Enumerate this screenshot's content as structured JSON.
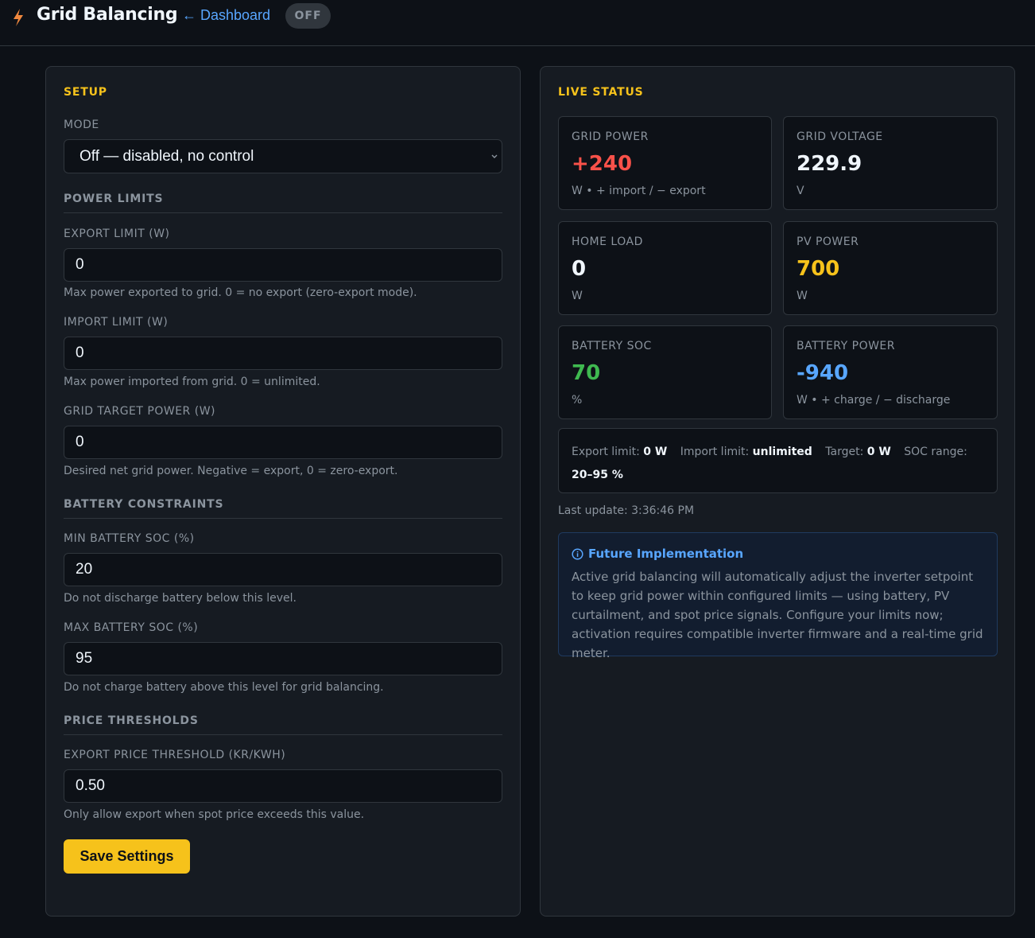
{
  "header": {
    "title": "Grid Balancing",
    "back_link": "← Dashboard",
    "status": "OFF",
    "icon": "lightning-bolt-icon"
  },
  "setup": {
    "title": "SETUP",
    "mode": {
      "label": "MODE",
      "selected": "Off — disabled, no control"
    },
    "power_limits": {
      "title": "POWER LIMITS",
      "export_limit": {
        "label": "EXPORT LIMIT (W)",
        "value": "0",
        "hint": "Max power exported to grid. 0 = no export (zero-export mode)."
      },
      "import_limit": {
        "label": "IMPORT LIMIT (W)",
        "value": "0",
        "hint": "Max power imported from grid. 0 = unlimited."
      },
      "grid_target": {
        "label": "GRID TARGET POWER (W)",
        "value": "0",
        "hint": "Desired net grid power. Negative = export, 0 = zero-export."
      }
    },
    "battery_constraints": {
      "title": "BATTERY CONSTRAINTS",
      "min_soc": {
        "label": "MIN BATTERY SOC (%)",
        "value": "20",
        "hint": "Do not discharge battery below this level."
      },
      "max_soc": {
        "label": "MAX BATTERY SOC (%)",
        "value": "95",
        "hint": "Do not charge battery above this level for grid balancing."
      }
    },
    "price_thresholds": {
      "title": "PRICE THRESHOLDS",
      "export_price": {
        "label": "EXPORT PRICE THRESHOLD (KR/KWH)",
        "value": "0.50",
        "hint": "Only allow export when spot price exceeds this value."
      }
    },
    "save_label": "Save Settings"
  },
  "live": {
    "title": "LIVE STATUS",
    "cards": {
      "grid_power": {
        "label": "GRID POWER",
        "value": "+240",
        "unit": "W  •  + import / − export",
        "color": "#f85149"
      },
      "grid_voltage": {
        "label": "GRID VOLTAGE",
        "value": "229.9",
        "unit": "V",
        "color": "#f0f6fc"
      },
      "home_load": {
        "label": "HOME LOAD",
        "value": "0",
        "unit": "W",
        "color": "#f0f6fc"
      },
      "pv_power": {
        "label": "PV POWER",
        "value": "700",
        "unit": "W",
        "color": "#f6c21b"
      },
      "battery_soc": {
        "label": "BATTERY SOC",
        "value": "70",
        "unit": "%",
        "color": "#3fb950"
      },
      "battery_power": {
        "label": "BATTERY POWER",
        "value": "-940",
        "unit": "W  •  + charge / − discharge",
        "color": "#58a6ff"
      }
    },
    "summary": {
      "export_label": "Export limit:",
      "export_value": "0 W",
      "import_label": "Import limit:",
      "import_value": "unlimited",
      "target_label": "Target:",
      "target_value": "0 W",
      "soc_label": "SOC range:",
      "soc_value": "20–95 %"
    },
    "last_update": "Last update: 3:36:46 PM",
    "notice": {
      "title": "Future Implementation",
      "body": "Active grid balancing will automatically adjust the inverter setpoint to keep grid power within configured limits — using battery, PV curtailment, and spot price signals. Configure your limits now; activation requires compatible inverter firmware and a real-time grid meter."
    }
  }
}
